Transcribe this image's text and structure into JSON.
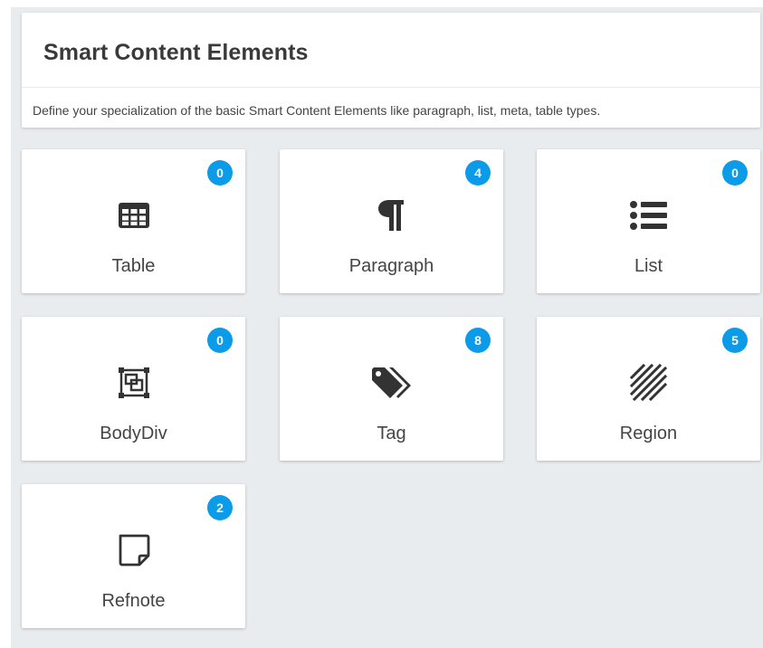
{
  "header": {
    "title": "Smart Content Elements",
    "description": "Define your specialization of the basic Smart Content Elements like paragraph, list, meta, table types."
  },
  "colors": {
    "badge": "#0b9be8",
    "icon": "#333333",
    "background": "#e9ecef"
  },
  "tiles": [
    {
      "label": "Table",
      "count": "0",
      "icon": "table-icon"
    },
    {
      "label": "Paragraph",
      "count": "4",
      "icon": "paragraph-icon"
    },
    {
      "label": "List",
      "count": "0",
      "icon": "list-icon"
    },
    {
      "label": "BodyDiv",
      "count": "0",
      "icon": "bodydiv-icon"
    },
    {
      "label": "Tag",
      "count": "8",
      "icon": "tag-icon"
    },
    {
      "label": "Region",
      "count": "5",
      "icon": "region-icon"
    },
    {
      "label": "Refnote",
      "count": "2",
      "icon": "refnote-icon"
    }
  ]
}
